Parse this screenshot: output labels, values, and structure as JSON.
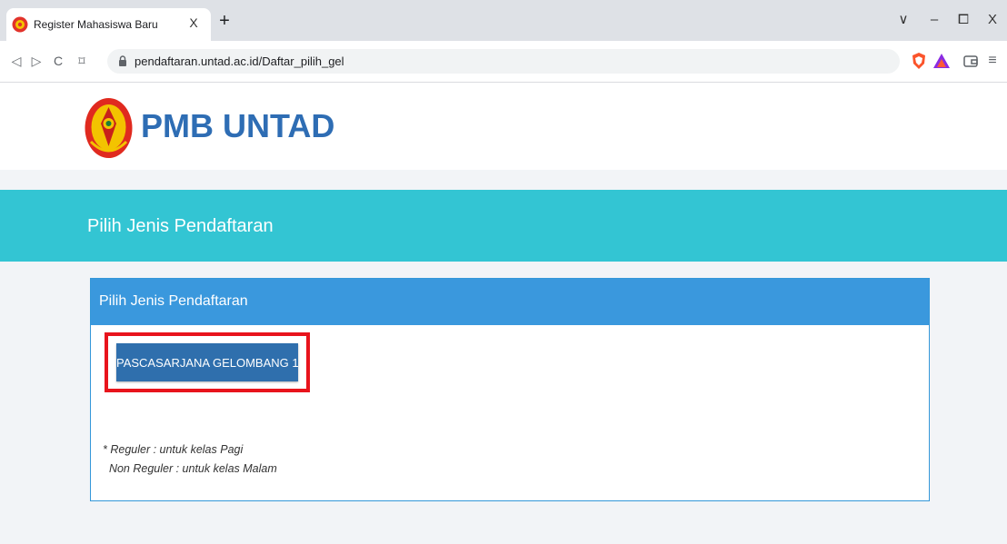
{
  "browser": {
    "tab_title": "Register Mahasiswa Baru",
    "tab_close": "X",
    "new_tab": "+",
    "window_controls": {
      "dropdown": "∨",
      "minimize": "–",
      "restore": "⧠",
      "close": "X"
    },
    "nav": {
      "back": "◁",
      "forward": "▷",
      "reload": "C",
      "bookmark": "⌑"
    },
    "url": "pendaftaran.untad.ac.id/Daftar_pilih_gel",
    "menu_icon": "≡"
  },
  "header": {
    "brand": "PMB UNTAD"
  },
  "banner": {
    "title": "Pilih Jenis Pendaftaran"
  },
  "panel": {
    "title": "Pilih Jenis Pendaftaran",
    "button_label": "PASCASARJANA GELOMBANG 1",
    "notes": [
      "* Reguler : untuk kelas Pagi",
      "  Non Reguler : untuk kelas Malam"
    ]
  },
  "colors": {
    "brand": "#2e6db4",
    "banner": "#33c5d3",
    "panel_header": "#3a98dd",
    "button": "#2f6fad",
    "highlight": "#e8141c"
  }
}
